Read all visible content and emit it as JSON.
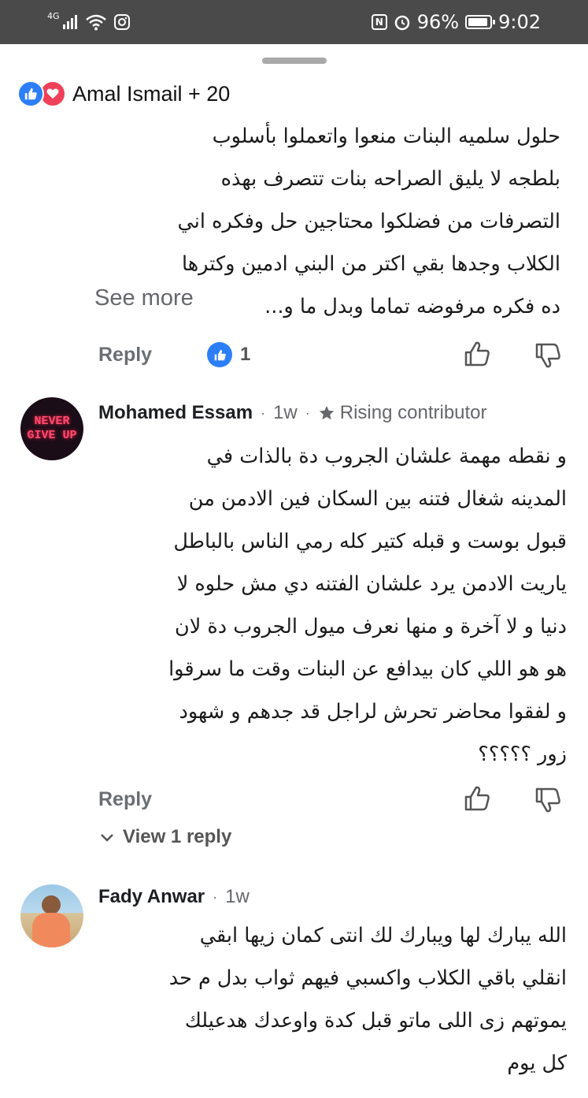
{
  "status_bar": {
    "network": "4G",
    "battery": "96%",
    "time": "9:02"
  },
  "comment1": {
    "reactors": "Amal Ismail + 20",
    "lines": [
      "حلول سلميه البنات منعوا واتعملوا بأسلوب",
      "بلطجه لا يليق الصراحه بنات تتصرف بهذه",
      "التصرفات من فضلكوا محتاجين حل وفكره اني",
      "الكلاب وجدها بقي اكتر من البني ادمين وكترها",
      "ده فكره مرفوضه تماما وبدل ما و..."
    ],
    "see_more": "See more",
    "reply": "Reply",
    "like_count": "1"
  },
  "comment2": {
    "author": "Mohamed Essam",
    "time": "1w",
    "badge": "Rising contributor",
    "avatar_text": [
      "NEVER",
      "GIVE UP"
    ],
    "lines": [
      "و نقطه مهمة علشان الجروب دة بالذات في",
      "المدينه شغال فتنه بين السكان فين الادمن من",
      "قبول بوست و قبله كتير كله رمي الناس بالباطل",
      "ياريت الادمن يرد علشان الفتنه دي مش حلوه لا",
      "دنيا و لا آخرة و منها نعرف ميول الجروب دة لان",
      "هو هو اللي كان بيدافع عن البنات وقت ما سرقوا",
      "و لفقوا محاضر تحرش لراجل قد جدهم و شهود",
      "زور ؟؟؟؟؟"
    ],
    "reply": "Reply",
    "view_replies": "View 1 reply"
  },
  "comment3": {
    "author": "Fady Anwar",
    "time": "1w",
    "lines": [
      "الله يبارك لها ويبارك لك انتى كمان زيها ابقي",
      "انقلي باقي الكلاب واكسبي فيهم ثواب بدل م حد",
      "يموتهم زى اللى ماتو قبل كدة واوعدك هدعيلك",
      "كل يوم"
    ]
  },
  "colors": {
    "status_bar_bg": "#4a4a4a",
    "like_blue": "#2d7ff9",
    "love_red": "#f0405a",
    "secondary_text": "#65676b"
  }
}
